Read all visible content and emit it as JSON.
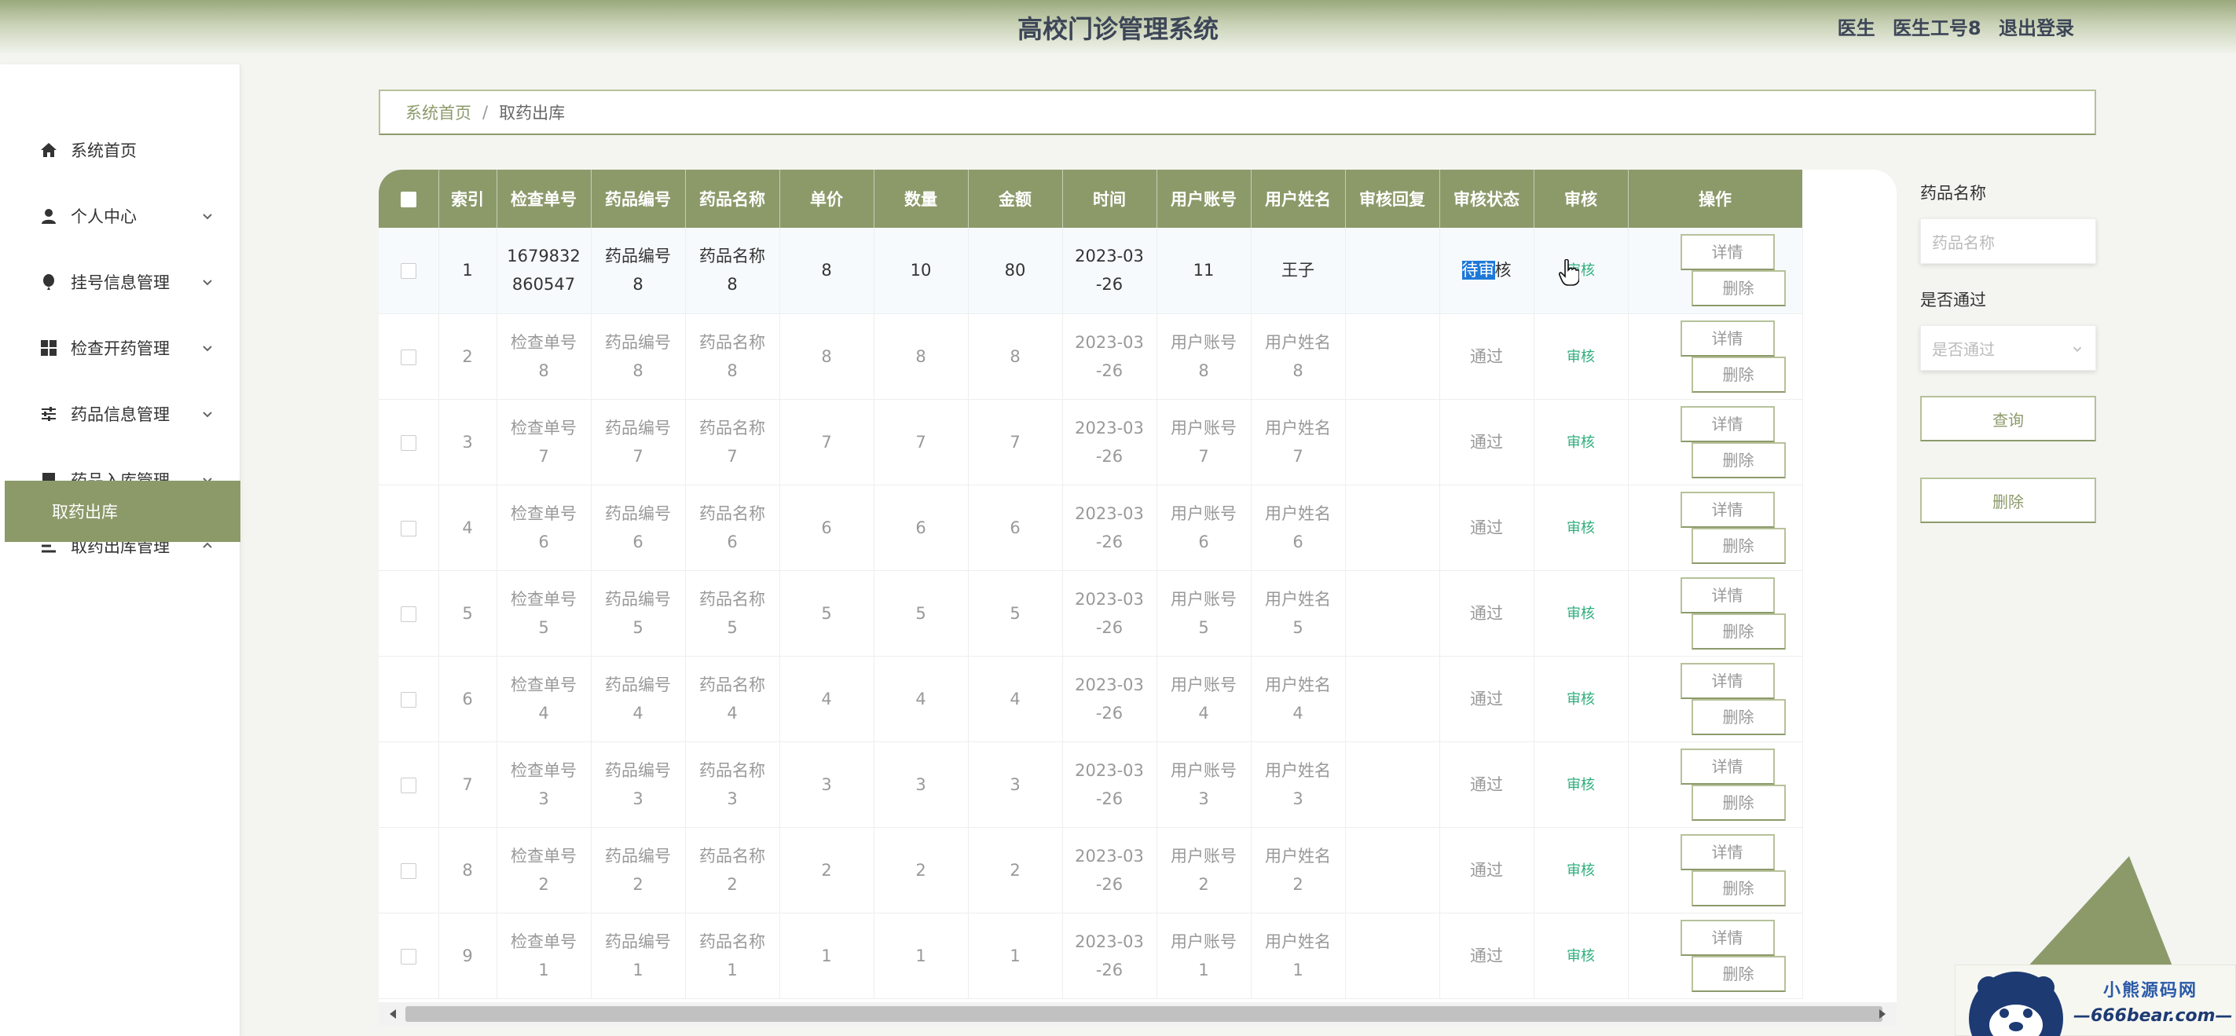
{
  "header": {
    "title": "高校门诊管理系统",
    "role": "医生",
    "username": "医生工号8",
    "logout": "退出登录"
  },
  "sidebar": {
    "items": [
      {
        "label": "系统首页",
        "icon": "home-icon"
      },
      {
        "label": "个人中心",
        "icon": "user-icon"
      },
      {
        "label": "挂号信息管理",
        "icon": "balloon-icon"
      },
      {
        "label": "检查开药管理",
        "icon": "grid-icon"
      },
      {
        "label": "药品信息管理",
        "icon": "sliders-icon"
      },
      {
        "label": "药品入库管理",
        "icon": "brush-icon"
      },
      {
        "label": "取药出库管理",
        "icon": "list-icon"
      }
    ],
    "active_sub": "取药出库"
  },
  "breadcrumb": {
    "home": "系统首页",
    "separator": "/",
    "current": "取药出库"
  },
  "table": {
    "headers": [
      "索引",
      "检查单号",
      "药品编号",
      "药品名称",
      "单价",
      "数量",
      "金额",
      "时间",
      "用户账号",
      "用户姓名",
      "审核回复",
      "审核状态",
      "审核",
      "操作"
    ],
    "detail_label": "详情",
    "delete_label": "删除",
    "rows": [
      {
        "idx": "1",
        "order_a": "1679832",
        "order_b": "860547",
        "code_a": "药品编号",
        "code_b": "8",
        "name_a": "药品名称",
        "name_b": "8",
        "price": "8",
        "qty": "10",
        "amount": "80",
        "time_a": "2023-03",
        "time_b": "-26",
        "acct_a": "11",
        "acct_b": "",
        "uname_a": "王子",
        "uname_b": "",
        "reply": "",
        "status_hl": "待审",
        "status_rest": "核",
        "status": "",
        "audit": "审核"
      },
      {
        "idx": "2",
        "order_a": "检查单号",
        "order_b": "8",
        "code_a": "药品编号",
        "code_b": "8",
        "name_a": "药品名称",
        "name_b": "8",
        "price": "8",
        "qty": "8",
        "amount": "8",
        "time_a": "2023-03",
        "time_b": "-26",
        "acct_a": "用户账号",
        "acct_b": "8",
        "uname_a": "用户姓名",
        "uname_b": "8",
        "reply": "",
        "status_hl": "",
        "status_rest": "",
        "status": "通过",
        "audit": "审核"
      },
      {
        "idx": "3",
        "order_a": "检查单号",
        "order_b": "7",
        "code_a": "药品编号",
        "code_b": "7",
        "name_a": "药品名称",
        "name_b": "7",
        "price": "7",
        "qty": "7",
        "amount": "7",
        "time_a": "2023-03",
        "time_b": "-26",
        "acct_a": "用户账号",
        "acct_b": "7",
        "uname_a": "用户姓名",
        "uname_b": "7",
        "reply": "",
        "status_hl": "",
        "status_rest": "",
        "status": "通过",
        "audit": "审核"
      },
      {
        "idx": "4",
        "order_a": "检查单号",
        "order_b": "6",
        "code_a": "药品编号",
        "code_b": "6",
        "name_a": "药品名称",
        "name_b": "6",
        "price": "6",
        "qty": "6",
        "amount": "6",
        "time_a": "2023-03",
        "time_b": "-26",
        "acct_a": "用户账号",
        "acct_b": "6",
        "uname_a": "用户姓名",
        "uname_b": "6",
        "reply": "",
        "status_hl": "",
        "status_rest": "",
        "status": "通过",
        "audit": "审核"
      },
      {
        "idx": "5",
        "order_a": "检查单号",
        "order_b": "5",
        "code_a": "药品编号",
        "code_b": "5",
        "name_a": "药品名称",
        "name_b": "5",
        "price": "5",
        "qty": "5",
        "amount": "5",
        "time_a": "2023-03",
        "time_b": "-26",
        "acct_a": "用户账号",
        "acct_b": "5",
        "uname_a": "用户姓名",
        "uname_b": "5",
        "reply": "",
        "status_hl": "",
        "status_rest": "",
        "status": "通过",
        "audit": "审核"
      },
      {
        "idx": "6",
        "order_a": "检查单号",
        "order_b": "4",
        "code_a": "药品编号",
        "code_b": "4",
        "name_a": "药品名称",
        "name_b": "4",
        "price": "4",
        "qty": "4",
        "amount": "4",
        "time_a": "2023-03",
        "time_b": "-26",
        "acct_a": "用户账号",
        "acct_b": "4",
        "uname_a": "用户姓名",
        "uname_b": "4",
        "reply": "",
        "status_hl": "",
        "status_rest": "",
        "status": "通过",
        "audit": "审核"
      },
      {
        "idx": "7",
        "order_a": "检查单号",
        "order_b": "3",
        "code_a": "药品编号",
        "code_b": "3",
        "name_a": "药品名称",
        "name_b": "3",
        "price": "3",
        "qty": "3",
        "amount": "3",
        "time_a": "2023-03",
        "time_b": "-26",
        "acct_a": "用户账号",
        "acct_b": "3",
        "uname_a": "用户姓名",
        "uname_b": "3",
        "reply": "",
        "status_hl": "",
        "status_rest": "",
        "status": "通过",
        "audit": "审核"
      },
      {
        "idx": "8",
        "order_a": "检查单号",
        "order_b": "2",
        "code_a": "药品编号",
        "code_b": "2",
        "name_a": "药品名称",
        "name_b": "2",
        "price": "2",
        "qty": "2",
        "amount": "2",
        "time_a": "2023-03",
        "time_b": "-26",
        "acct_a": "用户账号",
        "acct_b": "2",
        "uname_a": "用户姓名",
        "uname_b": "2",
        "reply": "",
        "status_hl": "",
        "status_rest": "",
        "status": "通过",
        "audit": "审核"
      },
      {
        "idx": "9",
        "order_a": "检查单号",
        "order_b": "1",
        "code_a": "药品编号",
        "code_b": "1",
        "name_a": "药品名称",
        "name_b": "1",
        "price": "1",
        "qty": "1",
        "amount": "1",
        "time_a": "2023-03",
        "time_b": "-26",
        "acct_a": "用户账号",
        "acct_b": "1",
        "uname_a": "用户姓名",
        "uname_b": "1",
        "reply": "",
        "status_hl": "",
        "status_rest": "",
        "status": "通过",
        "audit": "审核"
      }
    ]
  },
  "search": {
    "name_label": "药品名称",
    "name_placeholder": "药品名称",
    "pass_label": "是否通过",
    "pass_placeholder": "是否通过",
    "query_button": "查询",
    "delete_button": "删除"
  },
  "watermark": {
    "top": "小熊源码网",
    "bottom": "—666bear.com—"
  },
  "colors": {
    "accent": "#8c9a6a",
    "audit_link": "#2fae7d",
    "highlight": "#1e78d8"
  }
}
